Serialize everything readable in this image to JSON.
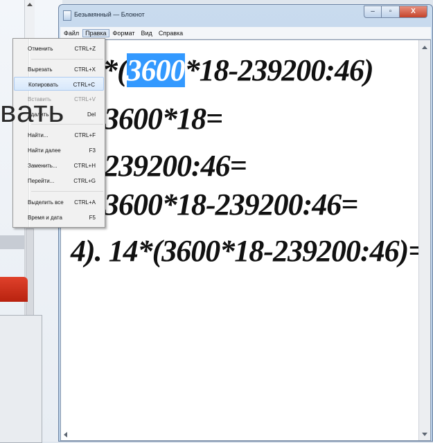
{
  "window": {
    "title": "Безымянный — Блокнот",
    "minimize": "–",
    "maximize": "▫",
    "close": "X"
  },
  "menubar": [
    "Файл",
    "Правка",
    "Формат",
    "Вид",
    "Справка"
  ],
  "active_menu": "Правка",
  "edit_menu": [
    {
      "label": "Отменить",
      "shortcut": "CTRL+Z",
      "state": "normal"
    },
    {
      "label": "Вырезать",
      "shortcut": "CTRL+X",
      "state": "normal"
    },
    {
      "label": "Копировать",
      "shortcut": "CTRL+C",
      "state": "highlighted"
    },
    {
      "label": "Вставить",
      "shortcut": "CTRL+V",
      "state": "disabled"
    },
    {
      "label": "Удалить",
      "shortcut": "Del",
      "state": "normal"
    },
    {
      "label": "Найти...",
      "shortcut": "CTRL+F",
      "state": "normal"
    },
    {
      "label": "Найти далее",
      "shortcut": "F3",
      "state": "normal"
    },
    {
      "label": "Заменить...",
      "shortcut": "CTRL+H",
      "state": "normal"
    },
    {
      "label": "Перейти...",
      "shortcut": "CTRL+G",
      "state": "normal"
    },
    {
      "label": "Выделить все",
      "shortcut": "CTRL+A",
      "state": "normal"
    },
    {
      "label": "Время и дата",
      "shortcut": "F5",
      "state": "normal"
    }
  ],
  "document": {
    "line1_prefix": "*(",
    "line1_selected": "3600",
    "line1_suffix": "*18-239200:46)",
    "line2": "3600*18=",
    "line3": "239200:46=",
    "line4": "3600*18-239200:46=",
    "line5": "4). 14*(3600*18-239200:46)="
  },
  "overlay": {
    "text": "вать"
  },
  "colors": {
    "selection": "#3399ff",
    "close_button": "#c5442b"
  }
}
